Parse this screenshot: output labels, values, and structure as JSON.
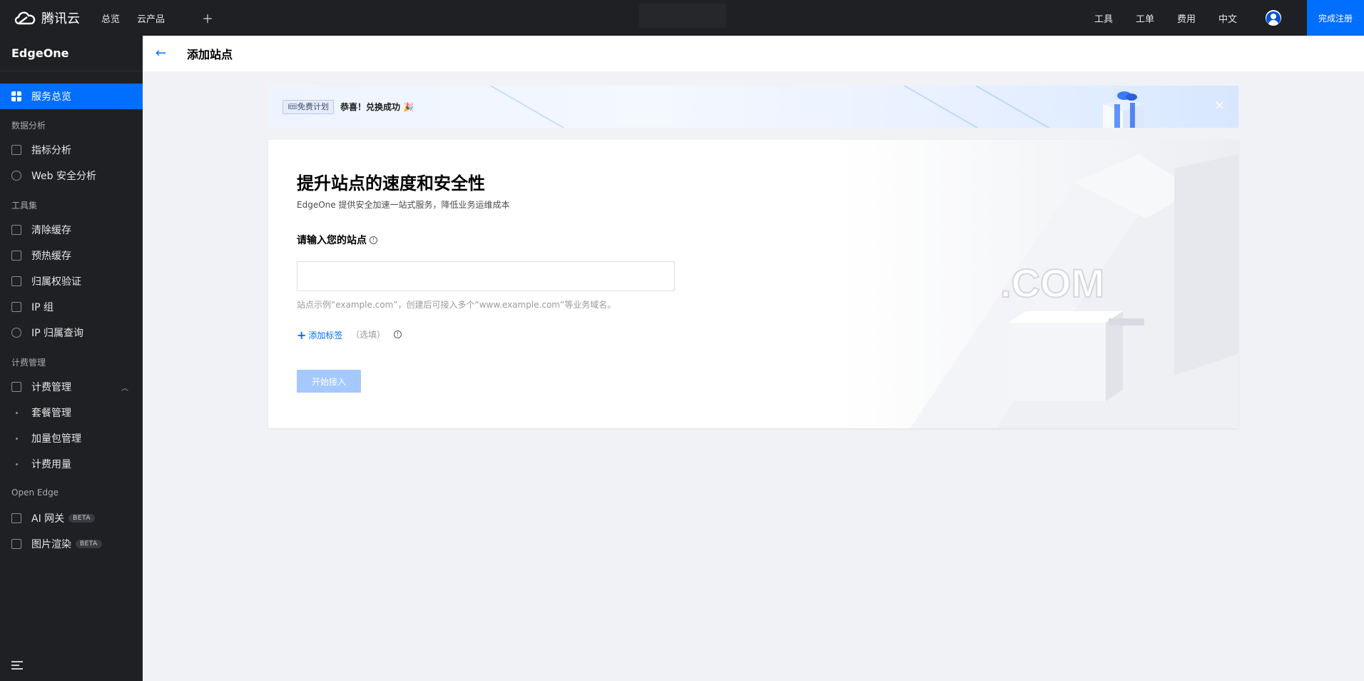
{
  "topbar": {
    "brand": "腾讯云",
    "nav": [
      "总览",
      "云产品"
    ],
    "add_label": "＋",
    "right_nav": [
      "工具",
      "工单",
      "费用",
      "中文"
    ],
    "register_label": "完成注册"
  },
  "sidebar": {
    "product": "EdgeOne",
    "active_item": "服务总览",
    "groups": {
      "data_analysis": "数据分析",
      "toolset": "工具集",
      "billing": "计费管理",
      "open_edge": "Open Edge"
    },
    "items": {
      "metrics": "指标分析",
      "web_security": "Web 安全分析",
      "purge_cache": "清除缓存",
      "prefetch_cache": "预热缓存",
      "ownership": "归属权验证",
      "ip_group": "IP 组",
      "ip_lookup": "IP 归属查询",
      "billing_mgmt": "计费管理",
      "plan_mgmt": "套餐管理",
      "addon_mgmt": "加量包管理",
      "billing_usage": "计费用量",
      "ai_gateway": "AI 网关",
      "image_render": "图片渲染"
    },
    "beta_badge": "BETA"
  },
  "page": {
    "title": "添加站点"
  },
  "banner": {
    "tag": "🎟免费计划",
    "message": "恭喜！兑换成功 🎉",
    "close_icon": "×"
  },
  "card": {
    "title": "提升站点的速度和安全性",
    "subtitle": "EdgeOne 提供安全加速一站式服务，降低业务运维成本",
    "field_label": "请输入您的站点",
    "input_value": "",
    "hint": "站点示例“example.com”，创建后可接入多个“www.example.com”等业务域名。",
    "add_tag_label": "添加标签",
    "optional_label": "（选填）",
    "start_button": "开始接入",
    "illustration_text": ".COM"
  },
  "colors": {
    "topbar": "#1f2024",
    "accent": "#006eff",
    "disabled_button": "#a5c8ff",
    "content_bg": "#f1f2f5"
  }
}
